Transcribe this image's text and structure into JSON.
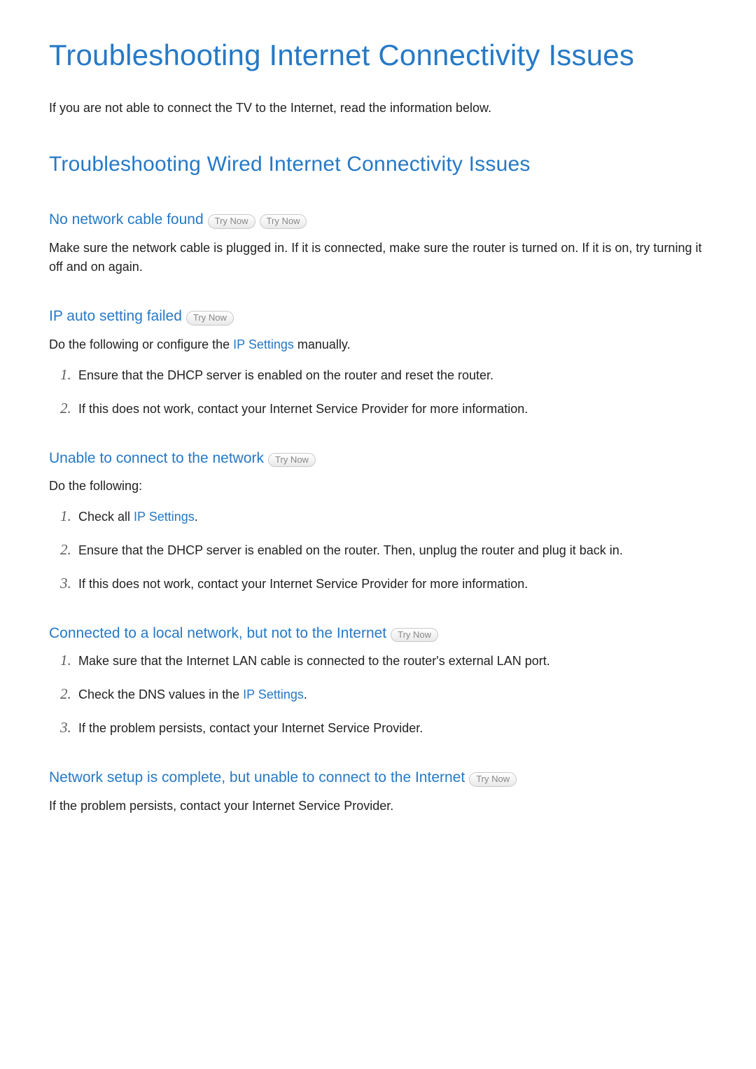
{
  "labels": {
    "try_now": "Try Now"
  },
  "title": "Troubleshooting Internet Connectivity Issues",
  "intro": "If you are not able to connect the TV to the Internet, read the information below.",
  "section_title": "Troubleshooting Wired Internet Connectivity Issues",
  "blocks": {
    "no_cable": {
      "heading": "No network cable found",
      "body": "Make sure the network cable is plugged in. If it is connected, make sure the router is turned on. If it is on, try turning it off and on again."
    },
    "ip_auto": {
      "heading": "IP auto setting failed",
      "lead_pre": "Do the following or configure the ",
      "lead_link": "IP Settings",
      "lead_post": " manually.",
      "steps": {
        "s1": "Ensure that the DHCP server is enabled on the router and reset the router.",
        "s2": "If this does not work, contact your Internet Service Provider for more information."
      }
    },
    "unable": {
      "heading": "Unable to connect to the network",
      "lead": "Do the following:",
      "steps": {
        "s1_pre": "Check all ",
        "s1_link": "IP Settings",
        "s1_post": ".",
        "s2": "Ensure that the DHCP server is enabled on the router. Then, unplug the router and plug it back in.",
        "s3": "If this does not work, contact your Internet Service Provider for more information."
      }
    },
    "local_only": {
      "heading": "Connected to a local network, but not to the Internet",
      "steps": {
        "s1": "Make sure that the Internet LAN cable is connected to the router's external LAN port.",
        "s2_pre": "Check the DNS values in the ",
        "s2_link": "IP Settings",
        "s2_post": ".",
        "s3": "If the problem persists, contact your Internet Service Provider."
      }
    },
    "setup_done": {
      "heading": "Network setup is complete, but unable to connect to the Internet",
      "body": "If the problem persists, contact your Internet Service Provider."
    }
  },
  "nums": {
    "n1": "1.",
    "n2": "2.",
    "n3": "3."
  }
}
